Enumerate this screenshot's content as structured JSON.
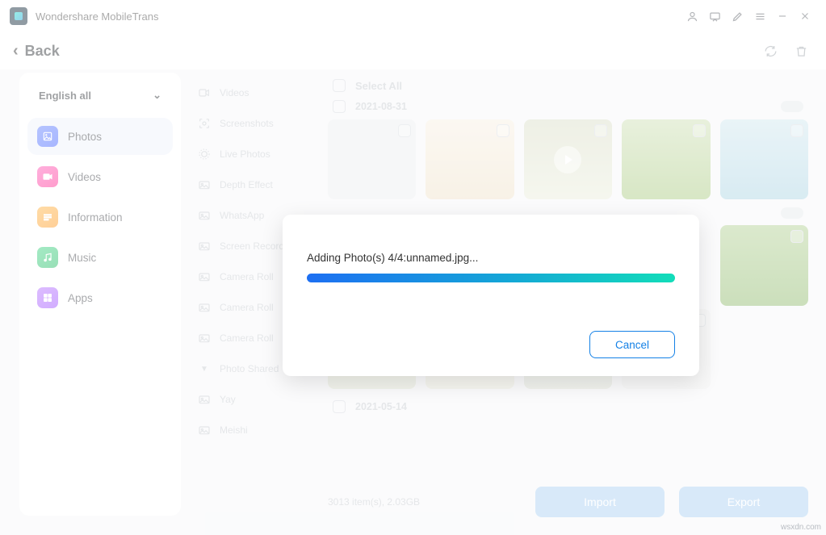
{
  "title": "Wondershare MobileTrans",
  "back": "Back",
  "dropdown": "English all",
  "categories": [
    {
      "label": "Photos",
      "active": true
    },
    {
      "label": "Videos",
      "active": false
    },
    {
      "label": "Information",
      "active": false
    },
    {
      "label": "Music",
      "active": false
    },
    {
      "label": "Apps",
      "active": false
    }
  ],
  "subcats": [
    "Videos",
    "Screenshots",
    "Live Photos",
    "Depth Effect",
    "WhatsApp",
    "Screen Recorder",
    "Camera Roll",
    "Camera Roll",
    "Camera Roll",
    "Photo Shared",
    "Yay",
    "Meishi"
  ],
  "selectAll": "Select All",
  "date1": "2021-08-31",
  "date2": "2021-05-14",
  "footerInfo": "3013 item(s), 2.03GB",
  "importLabel": "Import",
  "exportLabel": "Export",
  "modal": {
    "message": "Adding Photo(s) 4/4:unnamed.jpg...",
    "cancel": "Cancel"
  },
  "watermark": "wsxdn.com"
}
